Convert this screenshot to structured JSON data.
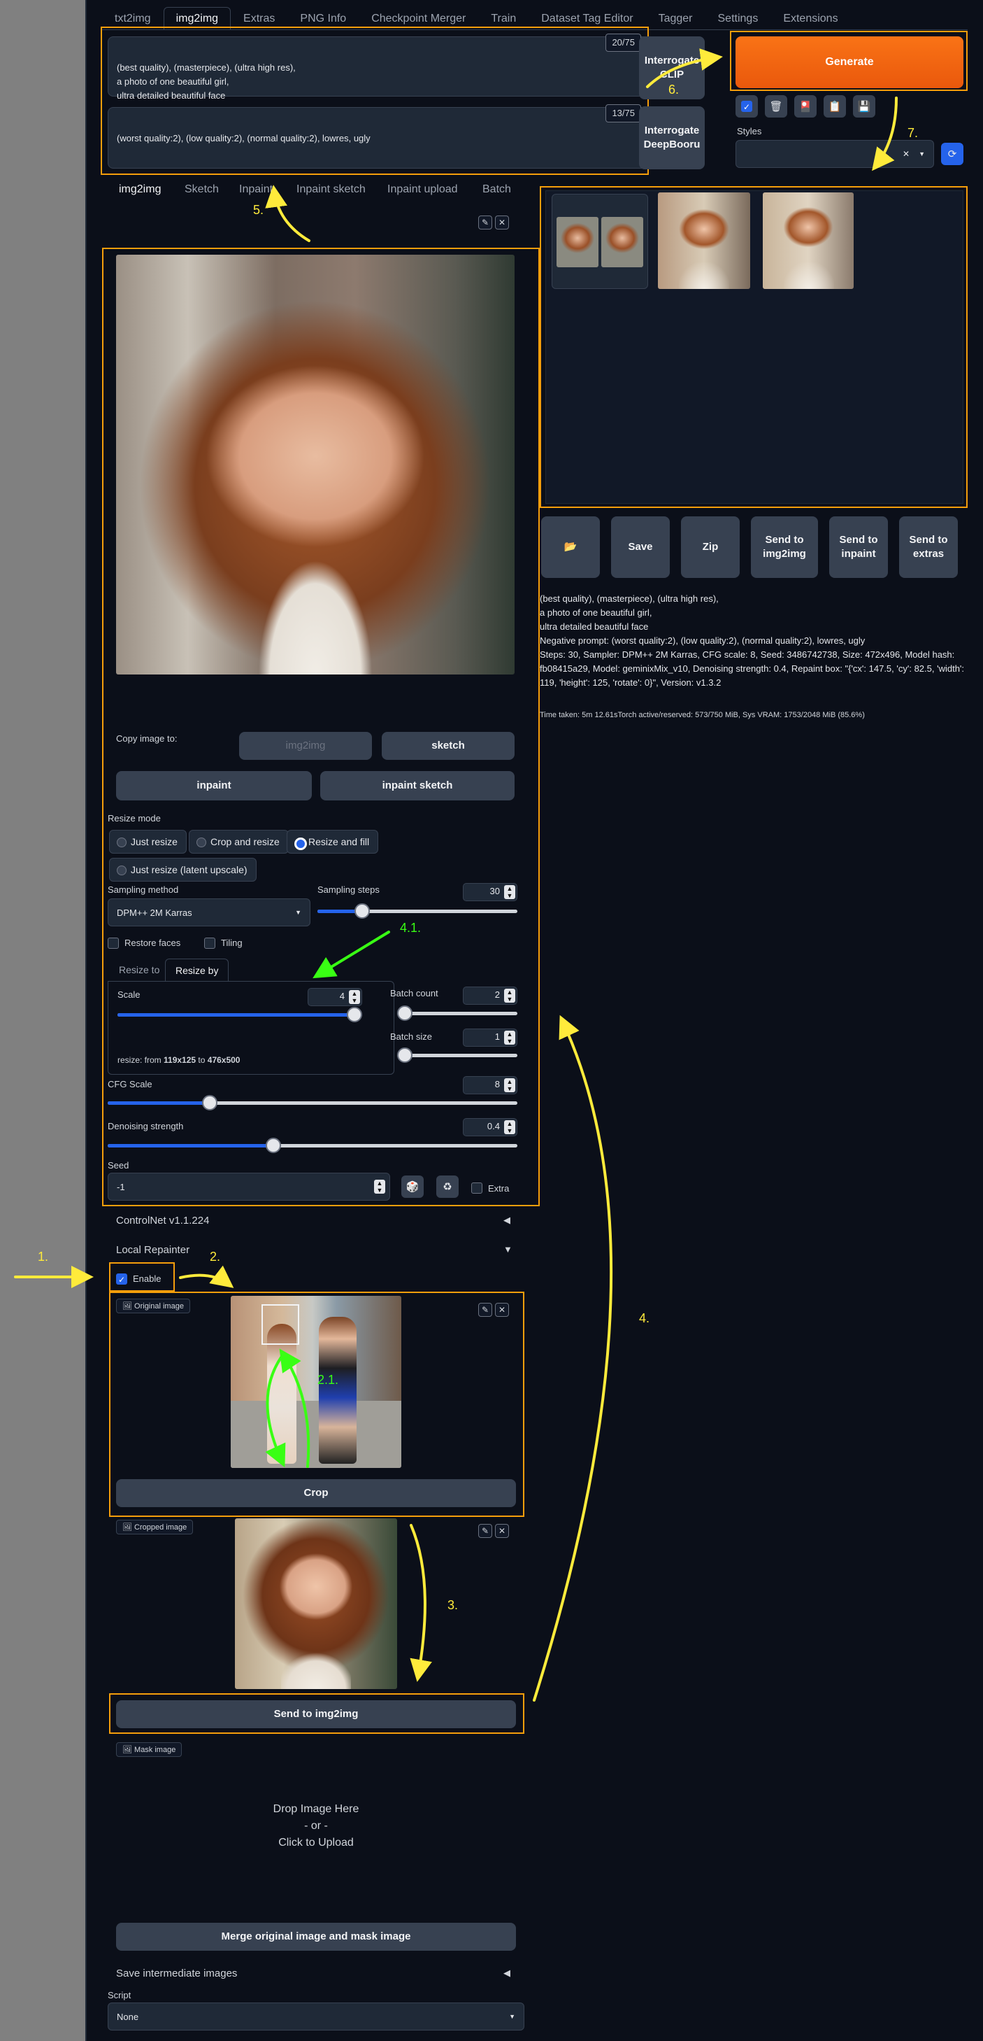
{
  "tabs": [
    "txt2img",
    "img2img",
    "Extras",
    "PNG Info",
    "Checkpoint Merger",
    "Train",
    "Dataset Tag Editor",
    "Tagger",
    "Settings",
    "Extensions"
  ],
  "prompt": {
    "text": "(best quality), (masterpiece), (ultra high res),\na photo of one beautiful girl,\nultra detailed beautiful face",
    "counter": "20/75"
  },
  "negative": {
    "text": "(worst quality:2), (low quality:2), (normal quality:2), lowres, ugly",
    "counter": "13/75"
  },
  "buttons": {
    "interrogate_clip": "Interrogate CLIP",
    "interrogate_deepbooru": "Interrogate DeepBooru",
    "generate": "Generate"
  },
  "styles_label": "Styles",
  "subtabs": [
    "img2img",
    "Sketch",
    "Inpaint",
    "Inpaint sketch",
    "Inpaint upload",
    "Batch"
  ],
  "copy_image": {
    "label": "Copy image to:",
    "img2img": "img2img",
    "sketch": "sketch",
    "inpaint": "inpaint",
    "inpaint_sketch": "inpaint sketch"
  },
  "resize_mode": {
    "label": "Resize mode",
    "options": [
      "Just resize",
      "Crop and resize",
      "Resize and fill",
      "Just resize (latent upscale)"
    ],
    "selected": "Resize and fill"
  },
  "sampling": {
    "method_label": "Sampling method",
    "method": "DPM++ 2M Karras",
    "steps_label": "Sampling steps",
    "steps": "30",
    "steps_fraction": 0.2
  },
  "restore_faces": "Restore faces",
  "tiling": "Tiling",
  "resize_tabs": [
    "Resize to",
    "Resize by"
  ],
  "scale": {
    "label": "Scale",
    "value": "4",
    "fraction": 1.0,
    "info_prefix": "resize: from ",
    "from": "119x125",
    "to_word": " to ",
    "to": "476x500"
  },
  "batch_count": {
    "label": "Batch count",
    "value": "2",
    "fraction": 0.0
  },
  "batch_size": {
    "label": "Batch size",
    "value": "1",
    "fraction": 0.0
  },
  "cfg": {
    "label": "CFG Scale",
    "value": "8",
    "fraction": 0.24
  },
  "denoise": {
    "label": "Denoising strength",
    "value": "0.4",
    "fraction": 0.4
  },
  "seed": {
    "label": "Seed",
    "value": "-1",
    "extra": "Extra"
  },
  "controlnet": "ControlNet v1.1.224",
  "local_repainter": {
    "title": "Local Repainter",
    "enable": "Enable",
    "original_image": "Original image",
    "crop": "Crop",
    "cropped_image": "Cropped image",
    "send": "Send to img2img",
    "mask_image": "Mask image",
    "drop": "Drop Image Here",
    "or": "- or -",
    "click": "Click to Upload",
    "merge": "Merge original image and mask image",
    "save_intermediate": "Save intermediate images"
  },
  "script": {
    "label": "Script",
    "value": "None"
  },
  "output_buttons": {
    "folder": "📂",
    "save": "Save",
    "zip": "Zip",
    "send_img2img": "Send to img2img",
    "send_inpaint": "Send to inpaint",
    "send_extras": "Send to extras"
  },
  "generation_info": "(best quality), (masterpiece), (ultra high res),\na photo of one beautiful girl,\nultra detailed beautiful face\nNegative prompt: (worst quality:2), (low quality:2), (normal quality:2), lowres, ugly\nSteps: 30, Sampler: DPM++ 2M Karras, CFG scale: 8, Seed: 3486742738, Size: 472x496, Model hash: fb08415a29, Model: geminixMix_v10, Denoising strength: 0.4, Repaint box: \"{'cx': 147.5, 'cy': 82.5, 'width': 119, 'height': 125, 'rotate': 0}\", Version: v1.3.2",
  "time_taken": "Time taken: 5m 12.61sTorch active/reserved: 573/750 MiB, Sys VRAM: 1753/2048 MiB (85.6%)",
  "annotations": [
    "1.",
    "2.",
    "2.1.",
    "3.",
    "4.",
    "4.1.",
    "5.",
    "6.",
    "7."
  ],
  "colors": {
    "accent": "#f59e0b",
    "generate": "#ea580c",
    "annotation": "#ffeb3b",
    "annotation_green": "#39ff14",
    "bg": "#0b0f19"
  }
}
